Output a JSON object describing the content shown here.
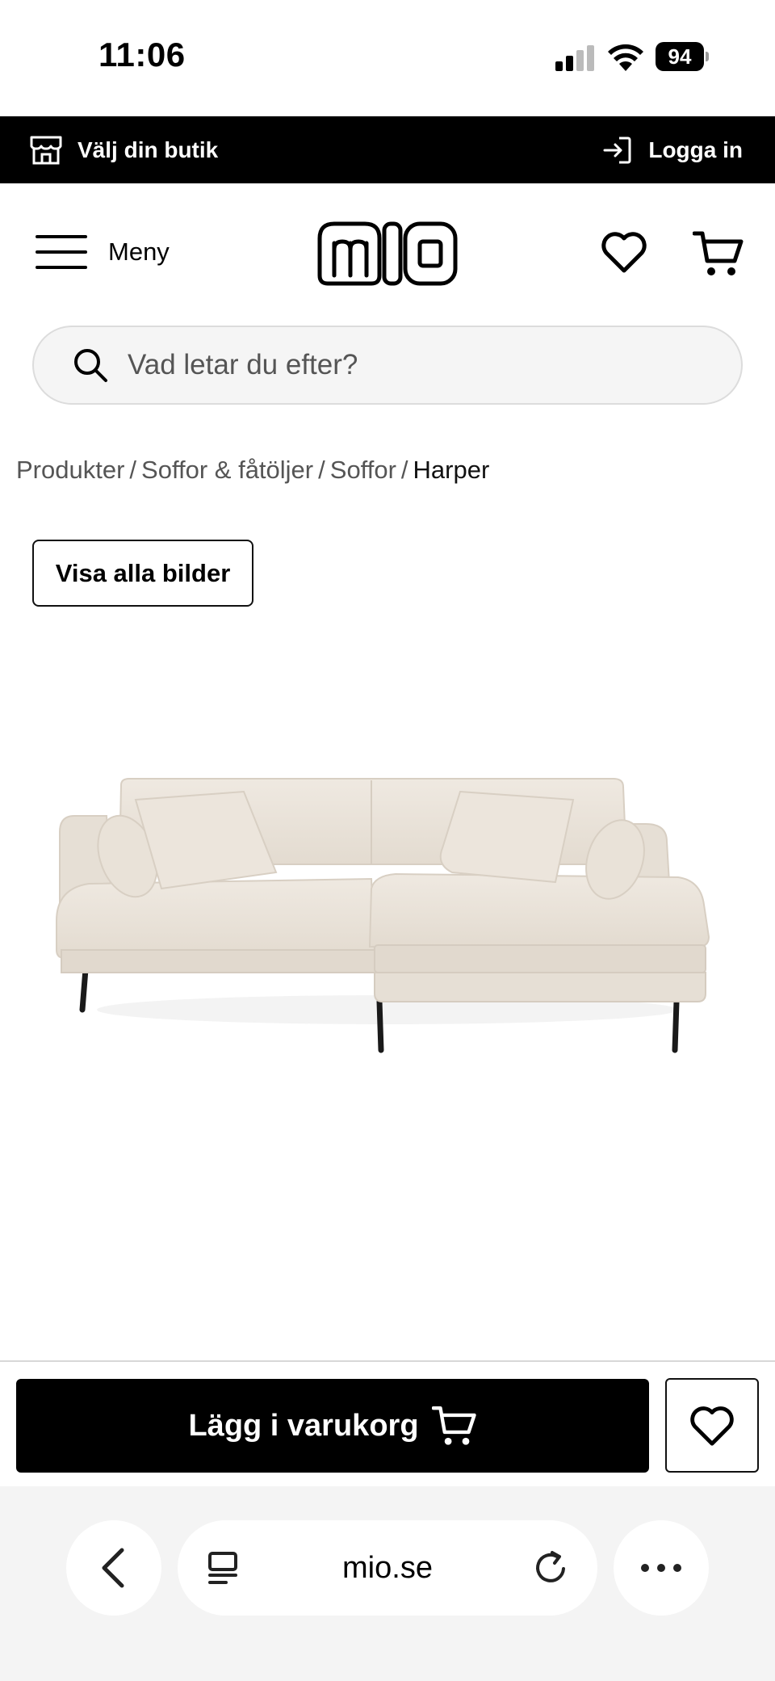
{
  "status_bar": {
    "time": "11:06",
    "battery_level": "94"
  },
  "top_bar": {
    "store_label": "Välj din butik",
    "login_label": "Logga in"
  },
  "header": {
    "menu_label": "Meny",
    "logo_text": "mio"
  },
  "search": {
    "placeholder": "Vad letar du efter?"
  },
  "breadcrumb": {
    "items": [
      "Produkter",
      "Soffor & fåtöljer",
      "Soffor"
    ],
    "current": "Harper",
    "separator": "/"
  },
  "gallery": {
    "show_all_label": "Visa alla bilder"
  },
  "actions": {
    "add_to_cart_label": "Lägg i varukorg"
  },
  "browser": {
    "url": "mio.se"
  },
  "colors": {
    "top_bar_bg": "#000000",
    "button_bg": "#000000",
    "search_bg": "#f5f5f5",
    "sofa_fabric": "#ece5dc"
  }
}
